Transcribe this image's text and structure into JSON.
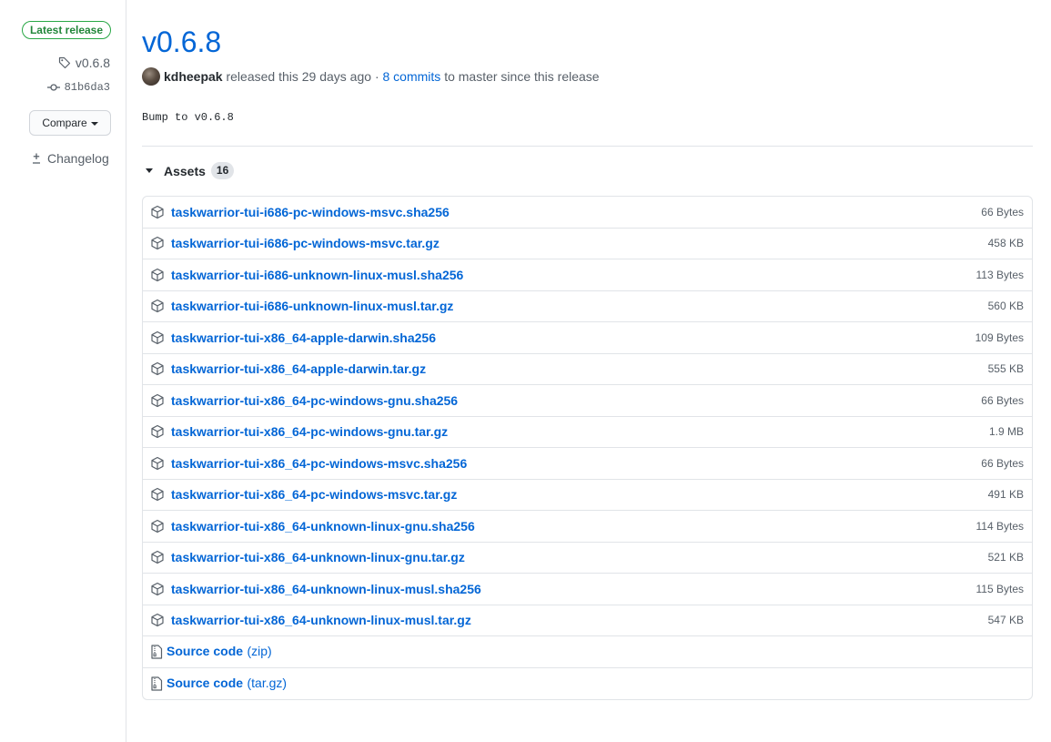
{
  "sidebar": {
    "latest_badge": "Latest release",
    "tag_name": "v0.6.8",
    "commit_sha": "81b6da3",
    "compare_label": "Compare",
    "changelog_label": "Changelog"
  },
  "release": {
    "title": "v0.6.8",
    "author": "kdheepak",
    "released_text": "released this 29 days ago",
    "separator": "·",
    "commits_link": "8 commits",
    "commits_suffix": "to master since this release",
    "body": "Bump to v0.6.8"
  },
  "assets": {
    "label": "Assets",
    "count": "16",
    "items": [
      {
        "name": "taskwarrior-tui-i686-pc-windows-msvc.sha256",
        "size": "66 Bytes"
      },
      {
        "name": "taskwarrior-tui-i686-pc-windows-msvc.tar.gz",
        "size": "458 KB"
      },
      {
        "name": "taskwarrior-tui-i686-unknown-linux-musl.sha256",
        "size": "113 Bytes"
      },
      {
        "name": "taskwarrior-tui-i686-unknown-linux-musl.tar.gz",
        "size": "560 KB"
      },
      {
        "name": "taskwarrior-tui-x86_64-apple-darwin.sha256",
        "size": "109 Bytes"
      },
      {
        "name": "taskwarrior-tui-x86_64-apple-darwin.tar.gz",
        "size": "555 KB"
      },
      {
        "name": "taskwarrior-tui-x86_64-pc-windows-gnu.sha256",
        "size": "66 Bytes"
      },
      {
        "name": "taskwarrior-tui-x86_64-pc-windows-gnu.tar.gz",
        "size": "1.9 MB"
      },
      {
        "name": "taskwarrior-tui-x86_64-pc-windows-msvc.sha256",
        "size": "66 Bytes"
      },
      {
        "name": "taskwarrior-tui-x86_64-pc-windows-msvc.tar.gz",
        "size": "491 KB"
      },
      {
        "name": "taskwarrior-tui-x86_64-unknown-linux-gnu.sha256",
        "size": "114 Bytes"
      },
      {
        "name": "taskwarrior-tui-x86_64-unknown-linux-gnu.tar.gz",
        "size": "521 KB"
      },
      {
        "name": "taskwarrior-tui-x86_64-unknown-linux-musl.sha256",
        "size": "115 Bytes"
      },
      {
        "name": "taskwarrior-tui-x86_64-unknown-linux-musl.tar.gz",
        "size": "547 KB"
      }
    ],
    "source": [
      {
        "name": "Source code",
        "ext": "(zip)"
      },
      {
        "name": "Source code",
        "ext": "(tar.gz)"
      }
    ]
  },
  "colors": {
    "link": "#0366d6",
    "badge_green": "#28a745",
    "muted": "#586069",
    "border": "#e1e4e8"
  },
  "icons": {
    "tag": "tag-icon",
    "commit": "git-commit-icon",
    "changelog": "diff-icon",
    "package": "package-icon",
    "archive": "file-zip-icon",
    "disclosure": "triangle-down-icon"
  }
}
